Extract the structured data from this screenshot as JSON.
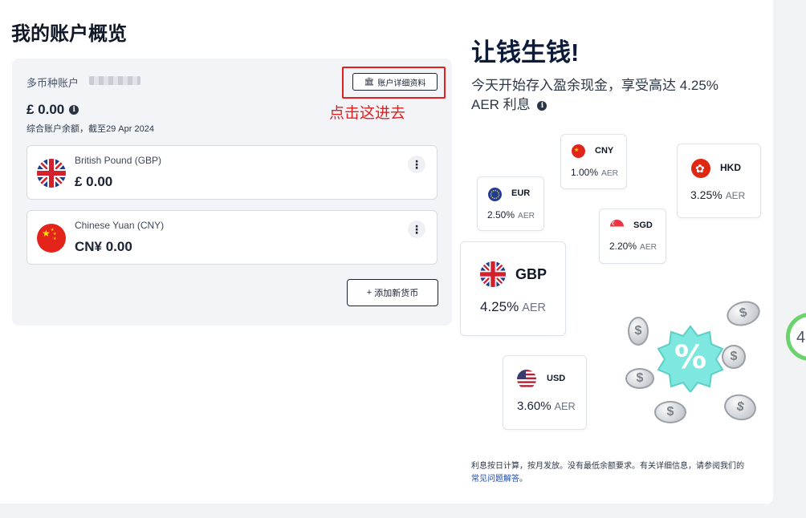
{
  "page_title": "我的账户概览",
  "account": {
    "label": "多币种账户",
    "details_button": "账户详细资料",
    "balance": "£ 0.00",
    "balance_note": "综合账户余额，截至29 Apr 2024",
    "currencies": [
      {
        "name": "British Pound (GBP)",
        "amount": "£ 0.00",
        "flag": "uk-flag-icon"
      },
      {
        "name": "Chinese Yuan (CNY)",
        "amount": "CN¥ 0.00",
        "flag": "china-flag-icon"
      }
    ],
    "add_currency_button": "添加新货币"
  },
  "annotation": "点击这进去",
  "promo": {
    "title": "让钱生钱!",
    "subtitle": "今天开始存入盈余现金，享受高达 4.25% AER 利息",
    "aer_label": "AER",
    "rates": {
      "cny": {
        "code": "CNY",
        "rate": "1.00%"
      },
      "hkd": {
        "code": "HKD",
        "rate": "3.25%"
      },
      "eur": {
        "code": "EUR",
        "rate": "2.50%"
      },
      "sgd": {
        "code": "SGD",
        "rate": "2.20%"
      },
      "gbp": {
        "code": "GBP",
        "rate": "4.25%"
      },
      "usd": {
        "code": "USD",
        "rate": "3.60%"
      }
    },
    "footnote": "利息按日计算，按月发放。没有最低余额要求。有关详细信息，请参阅我们的",
    "footnote_link": "常见问题解答",
    "footnote_end": "。",
    "percent_symbol": "%",
    "coin_symbol": "$"
  },
  "edge_text": "4",
  "colors": {
    "accent": "#0c1b3a",
    "highlight": "#e02020",
    "badge": "#7ee8e0"
  }
}
